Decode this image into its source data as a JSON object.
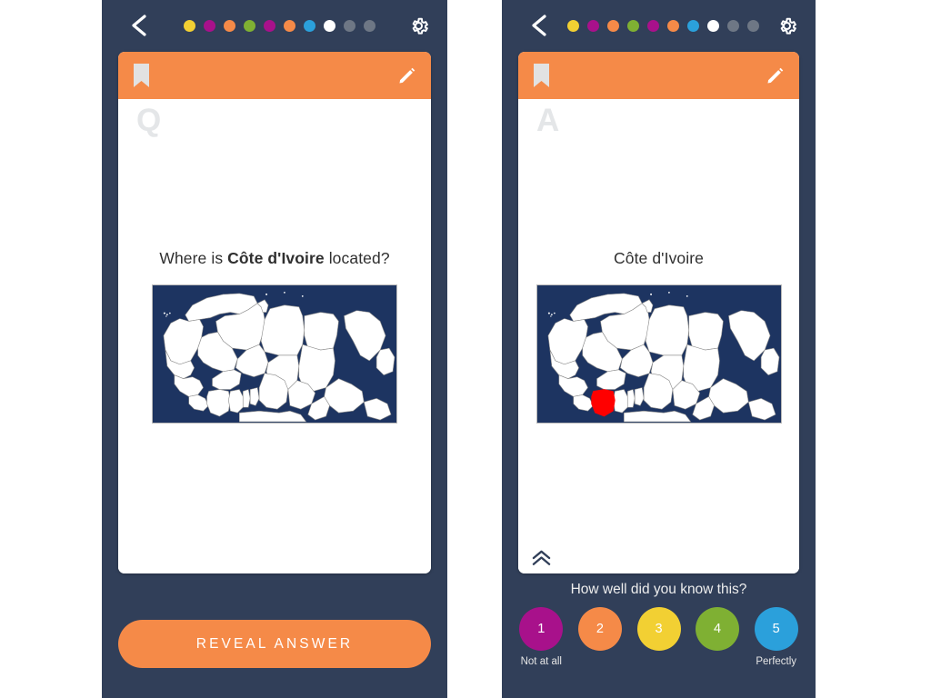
{
  "app": {
    "background_color": "#313F59",
    "accent_color": "#F58A48",
    "card_color": "#ffffff"
  },
  "topbar": {
    "back_icon": "chevron-left-icon",
    "settings_icon": "gear-icon",
    "progress_dots": [
      {
        "color": "#F2D033",
        "state": "done"
      },
      {
        "color": "#A8118B",
        "state": "done"
      },
      {
        "color": "#F58A48",
        "state": "done"
      },
      {
        "color": "#7FB033",
        "state": "done"
      },
      {
        "color": "#A8118B",
        "state": "done"
      },
      {
        "color": "#F58A48",
        "state": "done"
      },
      {
        "color": "#2BA0DB",
        "state": "done"
      },
      {
        "color": "#FFFFFF",
        "state": "current"
      },
      {
        "color": "#6E7785",
        "state": "pending"
      },
      {
        "color": "#6E7785",
        "state": "pending"
      }
    ]
  },
  "question_panel": {
    "header": {
      "bookmark_icon": "bookmark-icon",
      "edit_icon": "pencil-icon"
    },
    "watermark": "Q",
    "text_prefix": "Where is ",
    "text_bold": "Côte d'Ivoire",
    "text_suffix": " located?",
    "map": {
      "alt": "Map of northern and western Africa",
      "ocean_color": "#1D3461",
      "land_color": "#FFFFFF",
      "border_color": "#8A8A8A",
      "highlight_color": "#FF0000",
      "highlighted": false
    },
    "reveal_button_label": "REVEAL ANSWER"
  },
  "answer_panel": {
    "header": {
      "bookmark_icon": "bookmark-icon",
      "edit_icon": "pencil-icon"
    },
    "watermark": "A",
    "answer_text": "Côte d'Ivoire",
    "collapse_icon": "double-chevron-up-icon",
    "map": {
      "alt": "Map of northern and western Africa with Côte d'Ivoire highlighted",
      "ocean_color": "#1D3461",
      "land_color": "#FFFFFF",
      "border_color": "#8A8A8A",
      "highlight_color": "#FF0000",
      "highlighted": true,
      "highlighted_country": "Côte d'Ivoire"
    },
    "rating": {
      "prompt": "How well did you know this?",
      "min_label": "Not at all",
      "max_label": "Perfectly",
      "options": [
        {
          "value": "1",
          "color": "#A8118B",
          "label": "Not at all"
        },
        {
          "value": "2",
          "color": "#F58A48",
          "label": ""
        },
        {
          "value": "3",
          "color": "#F2D033",
          "label": ""
        },
        {
          "value": "4",
          "color": "#7FB033",
          "label": ""
        },
        {
          "value": "5",
          "color": "#2BA0DB",
          "label": "Perfectly"
        }
      ]
    }
  }
}
